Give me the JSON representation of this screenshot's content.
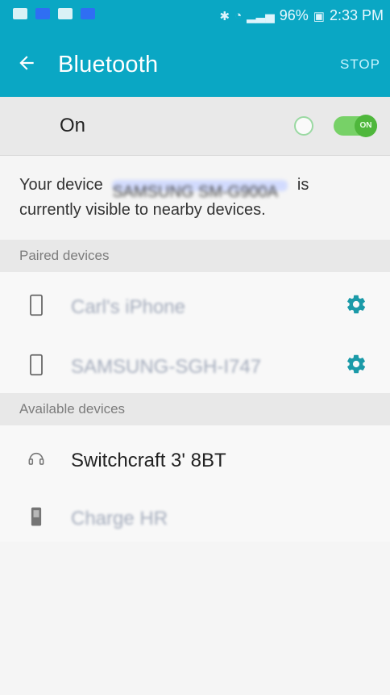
{
  "status_bar": {
    "battery": "96%",
    "time": "2:33 PM"
  },
  "header": {
    "title": "Bluetooth",
    "stop_label": "STOP"
  },
  "toggle": {
    "label": "On",
    "state_text": "ON"
  },
  "info": {
    "prefix": "Your device",
    "suffix": "is",
    "line2": "currently visible to nearby devices.",
    "blurred_device_name": "SAMSUNG SM-G900A"
  },
  "sections": {
    "paired_title": "Paired devices",
    "available_title": "Available devices"
  },
  "paired_devices": [
    {
      "name": "Carl's iPhone"
    },
    {
      "name": "SAMSUNG-SGH-I747"
    }
  ],
  "available_devices": [
    {
      "name": "Switchcraft 3' 8BT"
    },
    {
      "name": "Charge HR"
    }
  ],
  "colors": {
    "brand": "#0aa7c4",
    "switch_on": "#4fb73c",
    "gear": "#1b9aa8"
  }
}
